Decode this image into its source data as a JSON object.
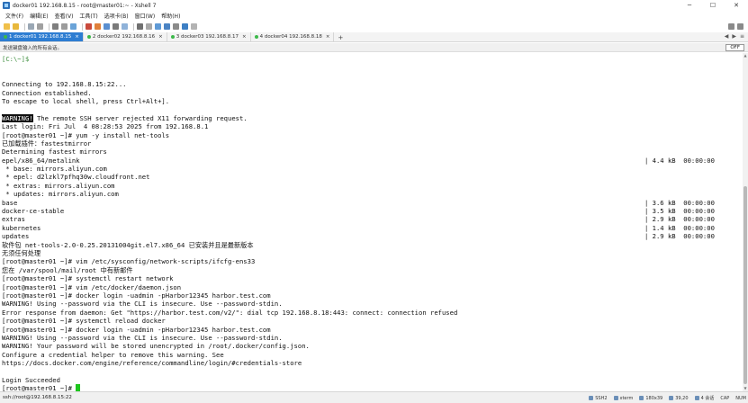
{
  "window": {
    "title": "docker01 192.168.8.15 - root@master01:~ - Xshell 7",
    "controls": [
      "─",
      "☐",
      "✕"
    ]
  },
  "menu": {
    "items": [
      "文件(F)",
      "编辑(E)",
      "查看(V)",
      "工具(T)",
      "选项卡(B)",
      "窗口(W)",
      "帮助(H)"
    ]
  },
  "tabs": [
    {
      "label": "1 docker01 192.168.8.15",
      "close": "×",
      "active": true,
      "dot": "#3cb94a"
    },
    {
      "label": "2 docker02 192.168.8.16",
      "close": "×",
      "active": false,
      "dot": "#3cb94a"
    },
    {
      "label": "3 docker03 192.168.8.17",
      "close": "×",
      "active": false,
      "dot": "#3cb94a"
    },
    {
      "label": "4 docker04 192.168.8.18",
      "close": "×",
      "active": false,
      "dot": "#3cb94a"
    }
  ],
  "tab_add": "+",
  "tab_nav": [
    "◀",
    "▶",
    "≡"
  ],
  "compose": {
    "text": "发送键盘输入的所有会话。",
    "off_label": "OFF"
  },
  "terminal": {
    "lines": [
      {
        "text": "[C:\\~]$",
        "color": "#3f8f3f"
      },
      {
        "text": ""
      },
      {
        "text": ""
      },
      {
        "text": "Connecting to 192.168.8.15:22..."
      },
      {
        "text": "Connection established."
      },
      {
        "text": "To escape to local shell, press Ctrl+Alt+]."
      },
      {
        "text": ""
      },
      {
        "hl": "WARNING!",
        "text": " The remote SSH server rejected X11 forwarding request."
      },
      {
        "text": "Last login: Fri Jul  4 08:28:53 2025 from 192.168.8.1"
      },
      {
        "text": "[root@master01 ~]# yum -y install net-tools"
      },
      {
        "text": "已加载插件：fastestmirror"
      },
      {
        "text": "Determining fastest mirrors"
      },
      {
        "text": "epel/x86_64/metalink",
        "right": "| 4.4 kB  00:00:00"
      },
      {
        "text": " * base: mirrors.aliyun.com"
      },
      {
        "text": " * epel: d2lzkl7pfhq30w.cloudfront.net"
      },
      {
        "text": " * extras: mirrors.aliyun.com"
      },
      {
        "text": " * updates: mirrors.aliyun.com"
      },
      {
        "text": "base",
        "right": "| 3.6 kB  00:00:00"
      },
      {
        "text": "docker-ce-stable",
        "right": "| 3.5 kB  00:00:00"
      },
      {
        "text": "extras",
        "right": "| 2.9 kB  00:00:00"
      },
      {
        "text": "kubernetes",
        "right": "| 1.4 kB  00:00:00"
      },
      {
        "text": "updates",
        "right": "| 2.9 kB  00:00:00"
      },
      {
        "text": "软件包 net-tools-2.0-0.25.20131004git.el7.x86_64 已安装并且是最新版本"
      },
      {
        "text": "无须任何处理"
      },
      {
        "text": "[root@master01 ~]# vim /etc/sysconfig/network-scripts/ifcfg-ens33"
      },
      {
        "text": "您在 /var/spool/mail/root 中有新邮件"
      },
      {
        "text": "[root@master01 ~]# systemctl restart network"
      },
      {
        "text": "[root@master01 ~]# vim /etc/docker/daemon.json"
      },
      {
        "text": "[root@master01 ~]# docker login -uadmin -pHarbor12345 harbor.test.com"
      },
      {
        "text": "WARNING! Using --password via the CLI is insecure. Use --password-stdin."
      },
      {
        "text": "Error response from daemon: Get \"https://harbor.test.com/v2/\": dial tcp 192.168.8.18:443: connect: connection refused"
      },
      {
        "text": "[root@master01 ~]# systemctl reload docker"
      },
      {
        "text": "[root@master01 ~]# docker login -uadmin -pHarbor12345 harbor.test.com"
      },
      {
        "text": "WARNING! Using --password via the CLI is insecure. Use --password-stdin."
      },
      {
        "text": "WARNING! Your password will be stored unencrypted in /root/.docker/config.json."
      },
      {
        "text": "Configure a credential helper to remove this warning. See"
      },
      {
        "text": "https://docs.docker.com/engine/reference/commandline/login/#credentials-store"
      },
      {
        "text": ""
      },
      {
        "text": "Login Succeeded"
      },
      {
        "text": "[root@master01 ~]# ",
        "cursor": true
      }
    ],
    "cursor_color": "#1ec71e"
  },
  "statusbar": {
    "connection": "ssh://root@192.168.8.15:22",
    "items": [
      "SSH2",
      "xterm",
      "180x39",
      "39,20",
      "4 会话",
      "CAP",
      "NUM"
    ]
  },
  "colors": {
    "tab_active": "#2d7dd2",
    "terminal_bg": "#ffffff",
    "terminal_fg": "#111111",
    "prompt_local": "#3f8f3f"
  }
}
